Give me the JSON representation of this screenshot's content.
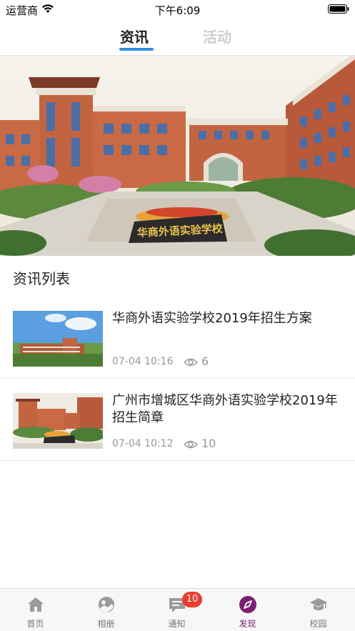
{
  "status_bar": {
    "carrier": "运营商",
    "time": "下午6:09"
  },
  "tabs": [
    {
      "label": "资讯",
      "active": true
    },
    {
      "label": "活动",
      "active": false
    }
  ],
  "banner": {
    "sign_text": "华商外语实验学校"
  },
  "section": {
    "title": "资讯列表"
  },
  "news": [
    {
      "title": "华商外语实验学校2019年招生方案",
      "date": "07-04 10:16",
      "views": "6"
    },
    {
      "title": "广州市增城区华商外语实验学校2019年招生简章",
      "date": "07-04 10:12",
      "views": "10"
    }
  ],
  "tabbar": [
    {
      "label": "首页",
      "icon": "home-icon"
    },
    {
      "label": "相册",
      "icon": "album-icon"
    },
    {
      "label": "通知",
      "icon": "message-icon",
      "badge": "10"
    },
    {
      "label": "发现",
      "icon": "compass-icon",
      "active": true
    },
    {
      "label": "校园",
      "icon": "graduation-cap-icon"
    }
  ],
  "colors": {
    "accent": "#2f8de4",
    "active_tab": "#7a1f72",
    "badge": "#ee3b2b"
  }
}
